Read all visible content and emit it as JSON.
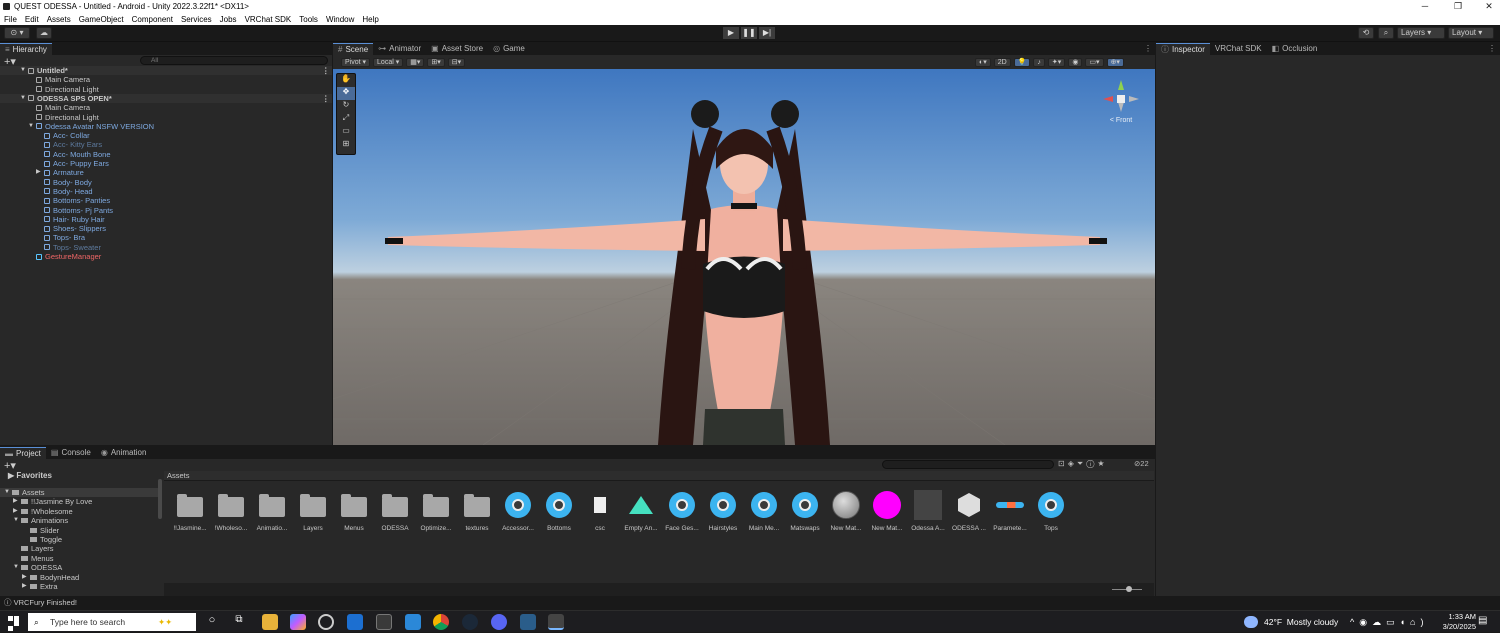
{
  "window": {
    "title": "QUEST ODESSA - Untitled - Android - Unity 2022.3.22f1* <DX11>",
    "controls": [
      "─",
      "❐",
      "✕"
    ]
  },
  "menu": [
    "File",
    "Edit",
    "Assets",
    "GameObject",
    "Component",
    "Services",
    "Jobs",
    "VRChat SDK",
    "Tools",
    "Window",
    "Help"
  ],
  "toolbar": {
    "account": "⊙ ▾",
    "cloud": "☁",
    "play": "▶",
    "pause": "❚❚",
    "step": "▶|",
    "layers": "Layers",
    "layout": "Layout"
  },
  "hierarchy": {
    "tab": "Hierarchy",
    "search_placeholder": "All",
    "rows": [
      {
        "text": "Untitled*",
        "indent": 0,
        "kind": "scene",
        "arrow": "▼"
      },
      {
        "text": "Main Camera",
        "indent": 1,
        "kind": "normal",
        "arrow": ""
      },
      {
        "text": "Directional Light",
        "indent": 1,
        "kind": "normal",
        "arrow": ""
      },
      {
        "text": "ODESSA SPS OPEN*",
        "indent": 0,
        "kind": "scene",
        "arrow": "▼"
      },
      {
        "text": "Main Camera",
        "indent": 1,
        "kind": "normal",
        "arrow": ""
      },
      {
        "text": "Directional Light",
        "indent": 1,
        "kind": "normal",
        "arrow": ""
      },
      {
        "text": "Odessa Avatar NSFW VERSION",
        "indent": 1,
        "kind": "blue",
        "arrow": "▼"
      },
      {
        "text": "Acc- Collar",
        "indent": 2,
        "kind": "blue",
        "arrow": ""
      },
      {
        "text": "Acc- Kitty Ears",
        "indent": 2,
        "kind": "dim",
        "arrow": ""
      },
      {
        "text": "Acc- Mouth Bone",
        "indent": 2,
        "kind": "blue",
        "arrow": ""
      },
      {
        "text": "Acc- Puppy Ears",
        "indent": 2,
        "kind": "blue",
        "arrow": ""
      },
      {
        "text": "Armature",
        "indent": 2,
        "kind": "blue",
        "arrow": "▶"
      },
      {
        "text": "Body- Body",
        "indent": 2,
        "kind": "blue",
        "arrow": ""
      },
      {
        "text": "Body- Head",
        "indent": 2,
        "kind": "blue",
        "arrow": ""
      },
      {
        "text": "Bottoms- Panties",
        "indent": 2,
        "kind": "blue",
        "arrow": ""
      },
      {
        "text": "Bottoms- Pj Pants",
        "indent": 2,
        "kind": "blue",
        "arrow": ""
      },
      {
        "text": "Hair- Ruby Hair",
        "indent": 2,
        "kind": "blue",
        "arrow": ""
      },
      {
        "text": "Shoes- Slippers",
        "indent": 2,
        "kind": "blue",
        "arrow": ""
      },
      {
        "text": "Tops- Bra",
        "indent": 2,
        "kind": "blue",
        "arrow": ""
      },
      {
        "text": "Tops- Sweater",
        "indent": 2,
        "kind": "dim",
        "arrow": ""
      },
      {
        "text": "GestureManager",
        "indent": 1,
        "kind": "red",
        "arrow": ""
      }
    ]
  },
  "scene_tabs": [
    "Scene",
    "Animator",
    "Asset Store",
    "Game"
  ],
  "scene_toolbar": {
    "pivot": "Pivot",
    "local": "Local",
    "mode_2d": "2D",
    "gizmo_label": "< Front"
  },
  "inspector_tabs": [
    "Inspector",
    "VRChat SDK",
    "Occlusion"
  ],
  "project": {
    "tabs": [
      "Project",
      "Console",
      "Animation"
    ],
    "favorites": "Favorites",
    "breadcrumb": "Assets",
    "count": "22",
    "tree": [
      {
        "text": "Assets",
        "indent": 0,
        "arrow": "▼"
      },
      {
        "text": "!!Jasmine By Love",
        "indent": 1,
        "arrow": "▶"
      },
      {
        "text": "!Wholesome",
        "indent": 1,
        "arrow": "▶"
      },
      {
        "text": "Animations",
        "indent": 1,
        "arrow": "▼"
      },
      {
        "text": "Slider",
        "indent": 2,
        "arrow": ""
      },
      {
        "text": "Toggle",
        "indent": 2,
        "arrow": ""
      },
      {
        "text": "Layers",
        "indent": 1,
        "arrow": ""
      },
      {
        "text": "Menus",
        "indent": 1,
        "arrow": ""
      },
      {
        "text": "ODESSA",
        "indent": 1,
        "arrow": "▼"
      },
      {
        "text": "BodynHead",
        "indent": 2,
        "arrow": "▶"
      },
      {
        "text": "Extra",
        "indent": 2,
        "arrow": "▶"
      }
    ],
    "assets": [
      {
        "label": "!!Jasmine...",
        "type": "folder"
      },
      {
        "label": "!Wholeso...",
        "type": "folder"
      },
      {
        "label": "Animatio...",
        "type": "folder"
      },
      {
        "label": "Layers",
        "type": "folder"
      },
      {
        "label": "Menus",
        "type": "folder"
      },
      {
        "label": "ODESSA",
        "type": "folder"
      },
      {
        "label": "Optimize...",
        "type": "folder"
      },
      {
        "label": "textures",
        "type": "folder"
      },
      {
        "label": "Accessor...",
        "type": "anim"
      },
      {
        "label": "Bottoms",
        "type": "anim"
      },
      {
        "label": "csc",
        "type": "file"
      },
      {
        "label": "Empty An...",
        "type": "clip"
      },
      {
        "label": "Face Ges...",
        "type": "anim"
      },
      {
        "label": "Hairstyles",
        "type": "anim"
      },
      {
        "label": "Main Me...",
        "type": "anim"
      },
      {
        "label": "Matswaps",
        "type": "anim"
      },
      {
        "label": "New Mat...",
        "type": "mat_gray"
      },
      {
        "label": "New Mat...",
        "type": "mat_pink"
      },
      {
        "label": "Odessa A...",
        "type": "prefab"
      },
      {
        "label": "ODESSA ...",
        "type": "unity"
      },
      {
        "label": "Paramete...",
        "type": "param"
      },
      {
        "label": "Tops",
        "type": "anim"
      }
    ]
  },
  "status": "VRCFury Finished!",
  "taskbar": {
    "search_placeholder": "Type here to search",
    "weather_temp": "42°F",
    "weather_desc": "Mostly cloudy",
    "time": "1:33 AM",
    "date": "3/20/2025"
  },
  "colors": {
    "accent": "#3a79d4",
    "selected_blue": "#7ea9e0",
    "missing_red": "#e66666",
    "pink_material": "#ff00ff"
  }
}
